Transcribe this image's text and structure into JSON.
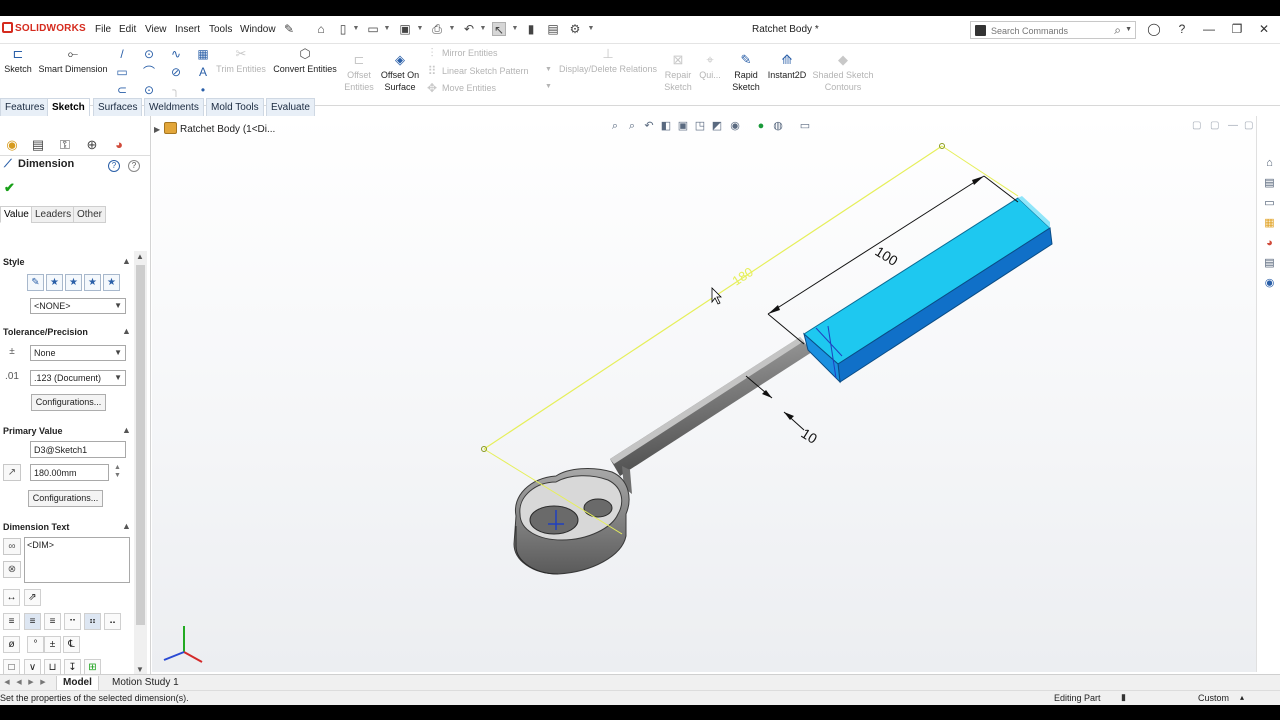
{
  "app": {
    "brand": "SOLIDWORKS",
    "document_title": "Ratchet Body *"
  },
  "menu": [
    "File",
    "Edit",
    "View",
    "Insert",
    "Tools",
    "Window"
  ],
  "search": {
    "placeholder": "Search Commands"
  },
  "commands": {
    "sketch": "Sketch",
    "smart_dimension": "Smart Dimension",
    "trim_entities": "Trim Entities",
    "convert_entities": "Convert Entities",
    "offset_entities": "Offset Entities",
    "offset_on_surface": "Offset On Surface",
    "mirror_entities": "Mirror Entities",
    "linear_sketch_pattern": "Linear Sketch Pattern",
    "move_entities": "Move Entities",
    "display_delete_relations": "Display/Delete Relations",
    "repair_sketch": "Repair Sketch",
    "quick_snaps": "Qui...",
    "rapid_sketch": "Rapid Sketch",
    "instant2d": "Instant2D",
    "shaded_sketch_contours": "Shaded Sketch Contours"
  },
  "tabs": [
    "Features",
    "Sketch",
    "Surfaces",
    "Weldments",
    "Mold Tools",
    "Evaluate"
  ],
  "active_tab": "Sketch",
  "feature_tree": {
    "root": "Ratchet Body  (1<Di..."
  },
  "property_manager": {
    "title": "Dimension",
    "subtabs": [
      "Value",
      "Leaders",
      "Other"
    ],
    "style": {
      "heading": "Style",
      "favorite": "<NONE>"
    },
    "tolerance": {
      "heading": "Tolerance/Precision",
      "type": "None",
      "precision": ".123 (Document)",
      "configurations": "Configurations..."
    },
    "primary_value": {
      "heading": "Primary Value",
      "name": "D3@Sketch1",
      "value": "180.00mm",
      "configurations": "Configurations..."
    },
    "dimension_text": {
      "heading": "Dimension Text",
      "text": "<DIM>"
    }
  },
  "model_annotations": {
    "dim_length_handle": "100",
    "dim_width": "10",
    "selected_dim": "180"
  },
  "bottom_tabs": [
    "Model",
    "Motion Study 1"
  ],
  "status": {
    "message": "Set the properties of the selected dimension(s).",
    "mode": "Editing Part",
    "units": "Custom"
  },
  "colors": {
    "accent": "#2a5fa8",
    "selected_face": "#1ec8f0",
    "selected_dimension": "#e6ef5a",
    "model_body": "#8c8c8c"
  }
}
